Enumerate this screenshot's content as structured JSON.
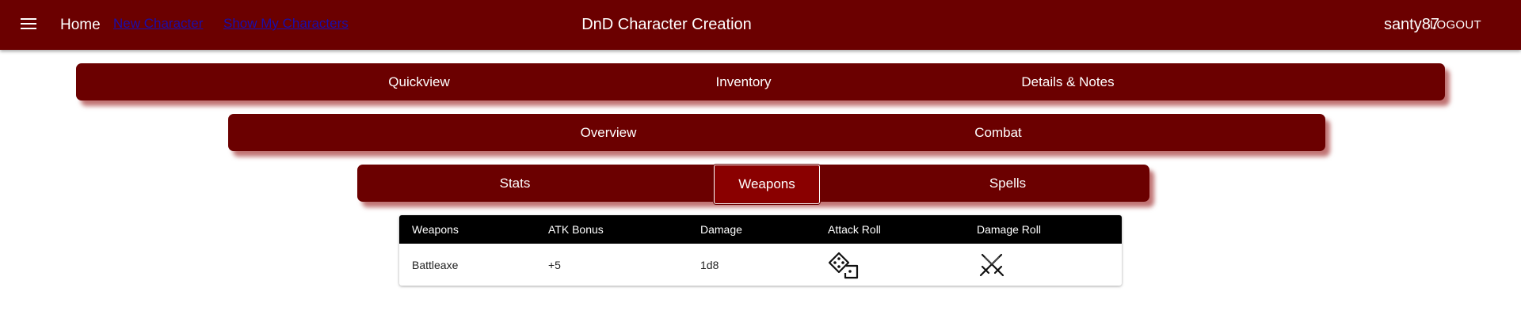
{
  "header": {
    "home_label": "Home",
    "new_character_label": "New Character",
    "show_my_characters_label": "Show My Characters",
    "title": "DnD Character Creation",
    "username": "santy87",
    "logout_label": "LOGOUT"
  },
  "main_tabs": [
    "Quickview",
    "Inventory",
    "Details & Notes"
  ],
  "quickview_tabs": [
    "Overview",
    "Combat"
  ],
  "combat_tabs": [
    "Stats",
    "Weapons",
    "Spells"
  ],
  "active_combat_tab": "Weapons",
  "weapons_table": {
    "headers": [
      "Weapons",
      "ATK Bonus",
      "Damage",
      "Attack Roll",
      "Damage Roll"
    ],
    "rows": [
      {
        "weapon": "Battleaxe",
        "atk_bonus": "+5",
        "damage": "1d8",
        "attack_roll_icon": "dice-icon",
        "damage_roll_icon": "crossed-swords-icon"
      }
    ]
  },
  "colors": {
    "primary": "#6b0000",
    "active_tab": "#8a0000",
    "table_header": "#000000",
    "link": "#1a0dab"
  }
}
